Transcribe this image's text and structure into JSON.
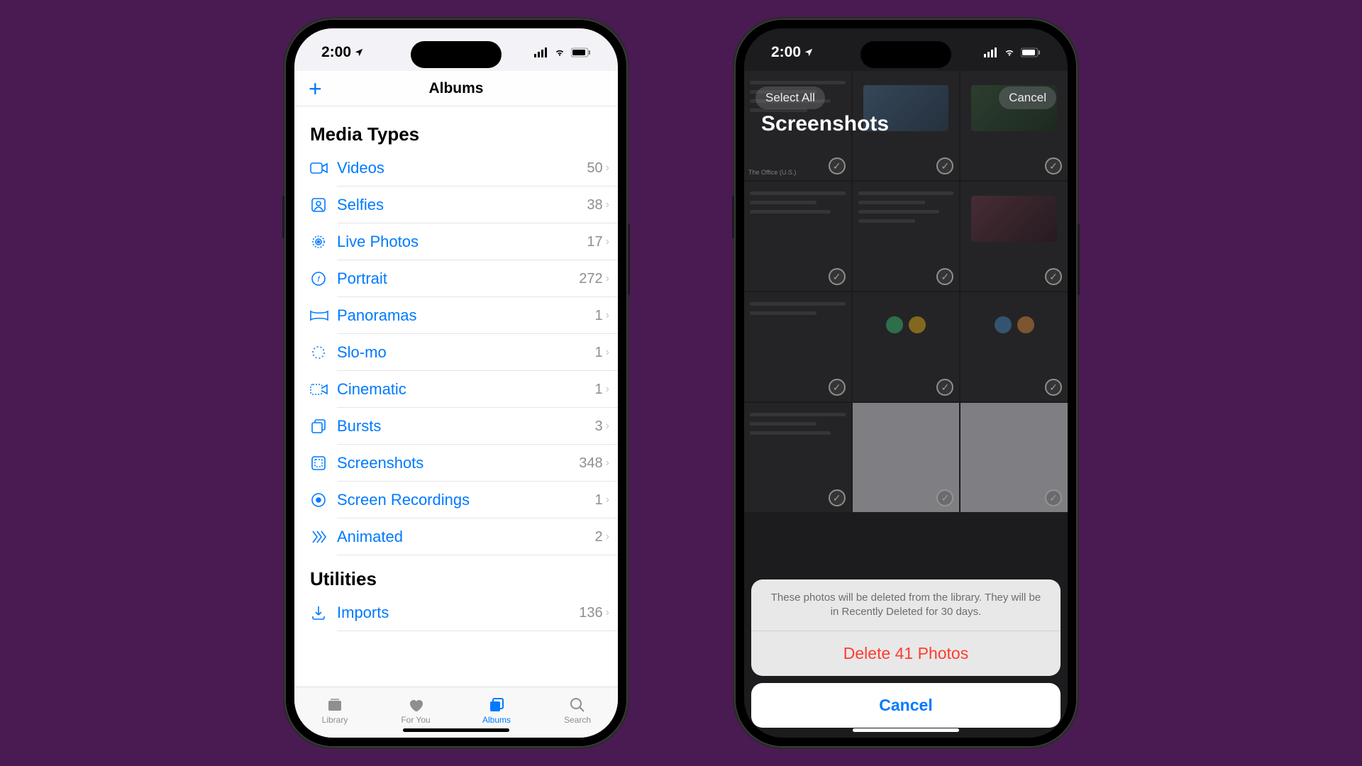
{
  "status": {
    "time": "2:00"
  },
  "phone1": {
    "nav_title": "Albums",
    "section1": "Media Types",
    "rows": [
      {
        "label": "Videos",
        "count": "50"
      },
      {
        "label": "Selfies",
        "count": "38"
      },
      {
        "label": "Live Photos",
        "count": "17"
      },
      {
        "label": "Portrait",
        "count": "272"
      },
      {
        "label": "Panoramas",
        "count": "1"
      },
      {
        "label": "Slo-mo",
        "count": "1"
      },
      {
        "label": "Cinematic",
        "count": "1"
      },
      {
        "label": "Bursts",
        "count": "3"
      },
      {
        "label": "Screenshots",
        "count": "348"
      },
      {
        "label": "Screen Recordings",
        "count": "1"
      },
      {
        "label": "Animated",
        "count": "2"
      }
    ],
    "section2": "Utilities",
    "utilities": [
      {
        "label": "Imports",
        "count": "136"
      }
    ],
    "tabs": {
      "library": "Library",
      "foryou": "For You",
      "albums": "Albums",
      "search": "Search"
    }
  },
  "phone2": {
    "select_all": "Select All",
    "cancel_top": "Cancel",
    "title": "Screenshots",
    "sheet_message": "These photos will be deleted from the library. They will be in Recently Deleted for 30 days.",
    "delete_label": "Delete 41 Photos",
    "cancel_label": "Cancel",
    "visible_thumb_text": "The Office (U.S.)"
  }
}
